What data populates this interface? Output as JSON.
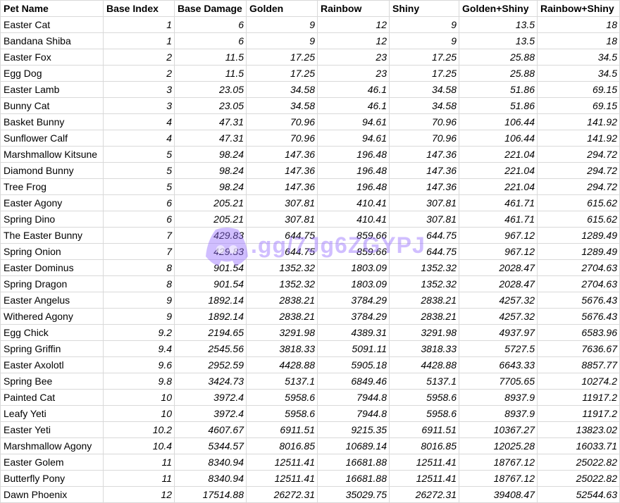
{
  "headers": [
    "Pet Name",
    "Base Index",
    "Base Damage",
    "Golden",
    "Rainbow",
    "Shiny",
    "Golden+Shiny",
    "Rainbow+Shiny"
  ],
  "rows": [
    [
      "Easter Cat",
      "1",
      "6",
      "9",
      "12",
      "9",
      "13.5",
      "18"
    ],
    [
      "Bandana Shiba",
      "1",
      "6",
      "9",
      "12",
      "9",
      "13.5",
      "18"
    ],
    [
      "Easter Fox",
      "2",
      "11.5",
      "17.25",
      "23",
      "17.25",
      "25.88",
      "34.5"
    ],
    [
      "Egg Dog",
      "2",
      "11.5",
      "17.25",
      "23",
      "17.25",
      "25.88",
      "34.5"
    ],
    [
      "Easter Lamb",
      "3",
      "23.05",
      "34.58",
      "46.1",
      "34.58",
      "51.86",
      "69.15"
    ],
    [
      "Bunny Cat",
      "3",
      "23.05",
      "34.58",
      "46.1",
      "34.58",
      "51.86",
      "69.15"
    ],
    [
      "Basket Bunny",
      "4",
      "47.31",
      "70.96",
      "94.61",
      "70.96",
      "106.44",
      "141.92"
    ],
    [
      "Sunflower Calf",
      "4",
      "47.31",
      "70.96",
      "94.61",
      "70.96",
      "106.44",
      "141.92"
    ],
    [
      "Marshmallow Kitsune",
      "5",
      "98.24",
      "147.36",
      "196.48",
      "147.36",
      "221.04",
      "294.72"
    ],
    [
      "Diamond Bunny",
      "5",
      "98.24",
      "147.36",
      "196.48",
      "147.36",
      "221.04",
      "294.72"
    ],
    [
      "Tree Frog",
      "5",
      "98.24",
      "147.36",
      "196.48",
      "147.36",
      "221.04",
      "294.72"
    ],
    [
      "Easter Agony",
      "6",
      "205.21",
      "307.81",
      "410.41",
      "307.81",
      "461.71",
      "615.62"
    ],
    [
      "Spring Dino",
      "6",
      "205.21",
      "307.81",
      "410.41",
      "307.81",
      "461.71",
      "615.62"
    ],
    [
      "The Easter Bunny",
      "7",
      "429.83",
      "644.75",
      "859.66",
      "644.75",
      "967.12",
      "1289.49"
    ],
    [
      "Spring Onion",
      "7",
      "429.83",
      "644.75",
      "859.66",
      "644.75",
      "967.12",
      "1289.49"
    ],
    [
      "Easter Dominus",
      "8",
      "901.54",
      "1352.32",
      "1803.09",
      "1352.32",
      "2028.47",
      "2704.63"
    ],
    [
      "Spring Dragon",
      "8",
      "901.54",
      "1352.32",
      "1803.09",
      "1352.32",
      "2028.47",
      "2704.63"
    ],
    [
      "Easter Angelus",
      "9",
      "1892.14",
      "2838.21",
      "3784.29",
      "2838.21",
      "4257.32",
      "5676.43"
    ],
    [
      "Withered Agony",
      "9",
      "1892.14",
      "2838.21",
      "3784.29",
      "2838.21",
      "4257.32",
      "5676.43"
    ],
    [
      "Egg Chick",
      "9.2",
      "2194.65",
      "3291.98",
      "4389.31",
      "3291.98",
      "4937.97",
      "6583.96"
    ],
    [
      "Spring Griffin",
      "9.4",
      "2545.56",
      "3818.33",
      "5091.11",
      "3818.33",
      "5727.5",
      "7636.67"
    ],
    [
      "Easter Axolotl",
      "9.6",
      "2952.59",
      "4428.88",
      "5905.18",
      "4428.88",
      "6643.33",
      "8857.77"
    ],
    [
      "Spring Bee",
      "9.8",
      "3424.73",
      "5137.1",
      "6849.46",
      "5137.1",
      "7705.65",
      "10274.2"
    ],
    [
      "Painted Cat",
      "10",
      "3972.4",
      "5958.6",
      "7944.8",
      "5958.6",
      "8937.9",
      "11917.2"
    ],
    [
      "Leafy Yeti",
      "10",
      "3972.4",
      "5958.6",
      "7944.8",
      "5958.6",
      "8937.9",
      "11917.2"
    ],
    [
      "Easter Yeti",
      "10.2",
      "4607.67",
      "6911.51",
      "9215.35",
      "6911.51",
      "10367.27",
      "13823.02"
    ],
    [
      "Marshmallow Agony",
      "10.4",
      "5344.57",
      "8016.85",
      "10689.14",
      "8016.85",
      "12025.28",
      "16033.71"
    ],
    [
      "Easter Golem",
      "11",
      "8340.94",
      "12511.41",
      "16681.88",
      "12511.41",
      "18767.12",
      "25022.82"
    ],
    [
      "Butterfly Pony",
      "11",
      "8340.94",
      "12511.41",
      "16681.88",
      "12511.41",
      "18767.12",
      "25022.82"
    ],
    [
      "Dawn Phoenix",
      "12",
      "17514.88",
      "26272.31",
      "35029.75",
      "26272.31",
      "39408.47",
      "52544.63"
    ]
  ],
  "watermark": {
    "text": ".gg/7Jg6ZGYPJ",
    "icon": "discord-logo-icon",
    "color": "#9966ff"
  }
}
